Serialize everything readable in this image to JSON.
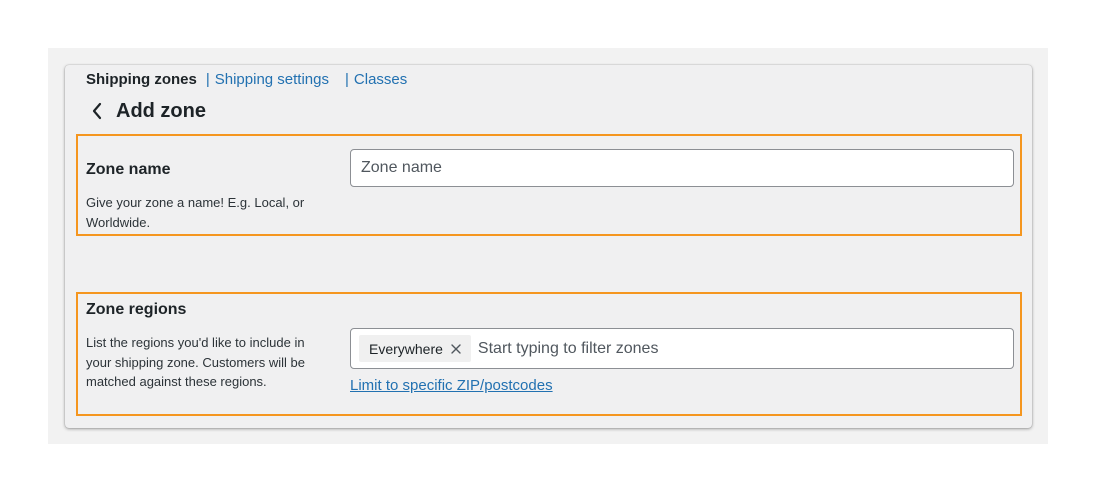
{
  "subnav": {
    "current": "Shipping zones",
    "separator": "|",
    "links": [
      "Shipping settings",
      "Classes"
    ]
  },
  "page": {
    "back_icon": "chevron-left-icon",
    "title": "Add zone"
  },
  "zone_name": {
    "title": "Zone name",
    "description": "Give your zone a name! E.g. Local, or Worldwide.",
    "input_value": "",
    "placeholder": "Zone name"
  },
  "zone_regions": {
    "title": "Zone regions",
    "description": "List the regions you'd like to include in your shipping zone. Customers will be matched against these regions.",
    "tokens": [
      {
        "label": "Everywhere",
        "remove_icon": "close-icon"
      }
    ],
    "placeholder": "Start typing to filter zones",
    "limit_link": "Limit to specific ZIP/postcodes"
  },
  "colors": {
    "link": "#2271b1",
    "highlight_border": "#f5961f",
    "panel_background": "#f0f0f1",
    "text": "#1d2327"
  }
}
